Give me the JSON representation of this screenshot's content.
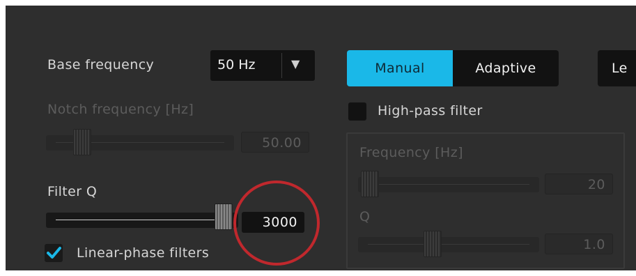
{
  "base_frequency": {
    "label": "Base frequency",
    "value": "50 Hz",
    "arrow_icon": "triangle-down"
  },
  "mode_tabs": [
    {
      "label": "Manual",
      "selected": true
    },
    {
      "label": "Adaptive",
      "selected": false
    },
    {
      "label": "Le",
      "selected": false
    }
  ],
  "notch": {
    "label": "Notch frequency [Hz]",
    "value": "50.00",
    "slider_fraction": 0.1,
    "enabled": false
  },
  "filter_q": {
    "label": "Filter Q",
    "value": "3000",
    "slider_fraction": 1.0
  },
  "linear_phase": {
    "label": "Linear-phase filters",
    "checked": true
  },
  "high_pass": {
    "label": "High-pass filter",
    "checked": false,
    "frequency": {
      "label": "Frequency [Hz]",
      "value": "20",
      "slider_fraction": 0.0
    },
    "q": {
      "label": "Q",
      "value": "1.0",
      "slider_fraction": 0.5
    }
  },
  "colors": {
    "panel": "#2e2e2e",
    "accent": "#1ab8e8",
    "annotation_circle": "#c0282d",
    "text": "#d6d6d6",
    "disabled_text": "#5c5c5c"
  }
}
